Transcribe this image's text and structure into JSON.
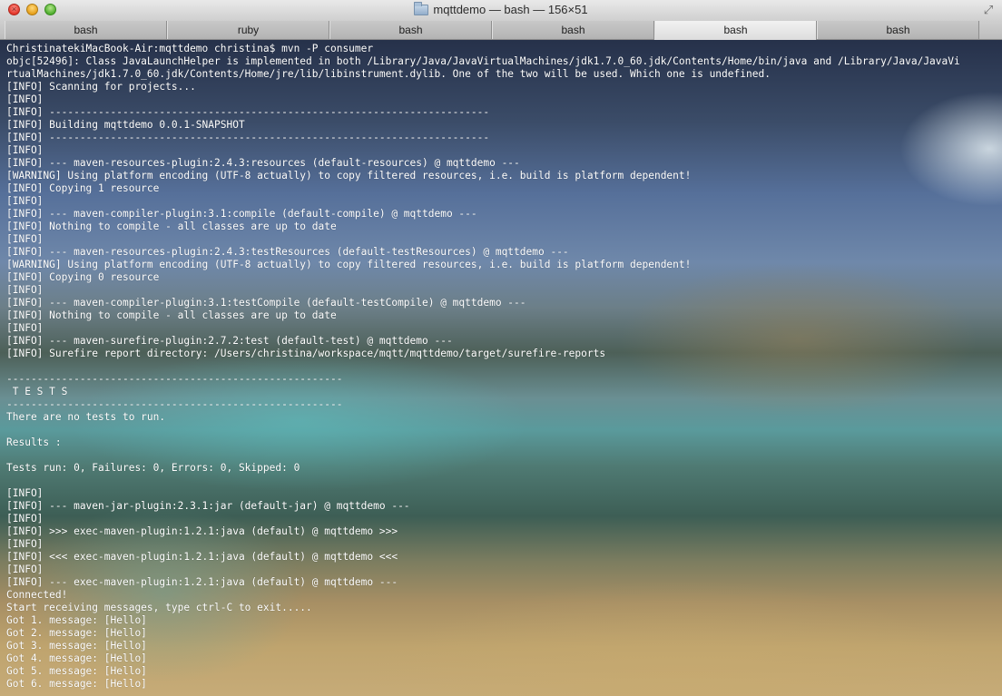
{
  "window": {
    "title": "mqttdemo — bash — 156×51"
  },
  "tabs": [
    {
      "label": "bash",
      "active": false
    },
    {
      "label": "ruby",
      "active": false
    },
    {
      "label": "bash",
      "active": false
    },
    {
      "label": "bash",
      "active": false
    },
    {
      "label": "bash",
      "active": true
    },
    {
      "label": "bash",
      "active": false
    }
  ],
  "icons": {
    "close": "close-icon",
    "minimize": "minimize-icon",
    "zoom": "zoom-icon",
    "folder": "folder-icon",
    "fullscreen": "fullscreen-icon"
  },
  "terminal": {
    "lines": [
      "ChristinatekiMacBook-Air:mqttdemo christina$ mvn -P consumer",
      "objc[52496]: Class JavaLaunchHelper is implemented in both /Library/Java/JavaVirtualMachines/jdk1.7.0_60.jdk/Contents/Home/bin/java and /Library/Java/JavaVi",
      "rtualMachines/jdk1.7.0_60.jdk/Contents/Home/jre/lib/libinstrument.dylib. One of the two will be used. Which one is undefined.",
      "[INFO] Scanning for projects...",
      "[INFO]",
      "[INFO] ------------------------------------------------------------------------",
      "[INFO] Building mqttdemo 0.0.1-SNAPSHOT",
      "[INFO] ------------------------------------------------------------------------",
      "[INFO]",
      "[INFO] --- maven-resources-plugin:2.4.3:resources (default-resources) @ mqttdemo ---",
      "[WARNING] Using platform encoding (UTF-8 actually) to copy filtered resources, i.e. build is platform dependent!",
      "[INFO] Copying 1 resource",
      "[INFO]",
      "[INFO] --- maven-compiler-plugin:3.1:compile (default-compile) @ mqttdemo ---",
      "[INFO] Nothing to compile - all classes are up to date",
      "[INFO]",
      "[INFO] --- maven-resources-plugin:2.4.3:testResources (default-testResources) @ mqttdemo ---",
      "[WARNING] Using platform encoding (UTF-8 actually) to copy filtered resources, i.e. build is platform dependent!",
      "[INFO] Copying 0 resource",
      "[INFO]",
      "[INFO] --- maven-compiler-plugin:3.1:testCompile (default-testCompile) @ mqttdemo ---",
      "[INFO] Nothing to compile - all classes are up to date",
      "[INFO]",
      "[INFO] --- maven-surefire-plugin:2.7.2:test (default-test) @ mqttdemo ---",
      "[INFO] Surefire report directory: /Users/christina/workspace/mqtt/mqttdemo/target/surefire-reports",
      "",
      "-------------------------------------------------------",
      " T E S T S",
      "-------------------------------------------------------",
      "There are no tests to run.",
      "",
      "Results :",
      "",
      "Tests run: 0, Failures: 0, Errors: 0, Skipped: 0",
      "",
      "[INFO]",
      "[INFO] --- maven-jar-plugin:2.3.1:jar (default-jar) @ mqttdemo ---",
      "[INFO]",
      "[INFO] >>> exec-maven-plugin:1.2.1:java (default) @ mqttdemo >>>",
      "[INFO]",
      "[INFO] <<< exec-maven-plugin:1.2.1:java (default) @ mqttdemo <<<",
      "[INFO]",
      "[INFO] --- exec-maven-plugin:1.2.1:java (default) @ mqttdemo ---",
      "Connected!",
      "Start receiving messages, type ctrl-C to exit.....",
      "Got 1. message: [Hello]",
      "Got 2. message: [Hello]",
      "Got 3. message: [Hello]",
      "Got 4. message: [Hello]",
      "Got 5. message: [Hello]",
      "Got 6. message: [Hello]"
    ]
  },
  "colors": {
    "text": "#ffffff",
    "close": "#e2362a",
    "minimize": "#e6a01c",
    "zoom": "#4fae2f"
  }
}
